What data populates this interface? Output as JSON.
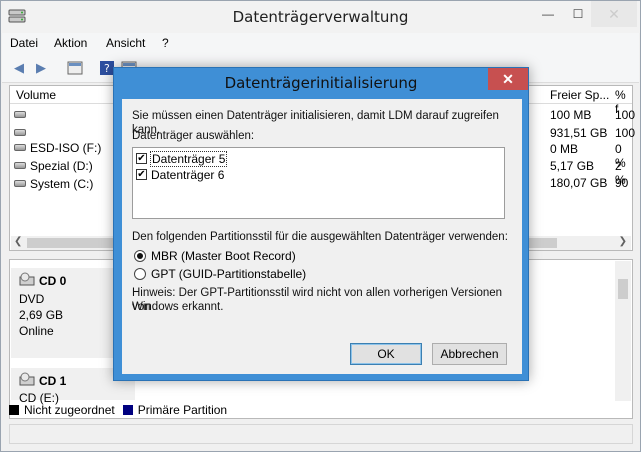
{
  "window": {
    "title": "Datenträgerverwaltung",
    "minimize_glyph": "—",
    "maximize_glyph": "☐",
    "close_glyph": "✕"
  },
  "menu": [
    "Datei",
    "Aktion",
    "Ansicht",
    "?"
  ],
  "toolbar": {
    "icons": [
      "back-icon",
      "forward-icon",
      "properties-icon",
      "help-icon",
      "refresh-icon",
      "delete-icon",
      "settings-icon",
      "folder-icon",
      "search-icon",
      "disk-icon"
    ]
  },
  "volume_list": {
    "columns": [
      "Volume",
      "Freier Sp...",
      "% f"
    ],
    "rows": [
      {
        "name": "",
        "free": "100 MB",
        "pct": "100"
      },
      {
        "name": "",
        "free": "931,51 GB",
        "pct": "100"
      },
      {
        "name": "ESD-ISO (F:)",
        "free": "0 MB",
        "pct": "0 %"
      },
      {
        "name": "Spezial (D:)",
        "free": "5,17 GB",
        "pct": "2 %"
      },
      {
        "name": "System (C:)",
        "free": "180,07 GB",
        "pct": "90"
      }
    ]
  },
  "disks": [
    {
      "title": "CD 0",
      "type": "DVD",
      "size": "2,69 GB",
      "status": "Online"
    },
    {
      "title": "CD 1",
      "type": "CD (E:)"
    }
  ],
  "legend": [
    {
      "label": "Nicht zugeordnet",
      "color": "#000000"
    },
    {
      "label": "Primäre Partition",
      "color": "#00007f"
    }
  ],
  "dialog": {
    "title": "Datenträgerinitialisierung",
    "close_glyph": "✕",
    "intro": "Sie müssen einen Datenträger initialisieren, damit LDM darauf zugreifen kann.",
    "select_label": "Datenträger auswählen:",
    "disks": [
      {
        "label": "Datenträger 5",
        "checked": true
      },
      {
        "label": "Datenträger 6",
        "checked": true
      }
    ],
    "style_label": "Den folgenden Partitionsstil für die ausgewählten Datenträger verwenden:",
    "options": [
      {
        "label": "MBR (Master Boot Record)",
        "selected": true
      },
      {
        "label": "GPT (GUID-Partitionstabelle)",
        "selected": false
      }
    ],
    "note_line1": "Hinweis: Der GPT-Partitionsstil wird nicht von allen vorherigen Versionen von",
    "note_line2": "Windows erkannt.",
    "ok_label": "OK",
    "cancel_label": "Abbrechen",
    "accent_color": "#3f8fd6"
  }
}
